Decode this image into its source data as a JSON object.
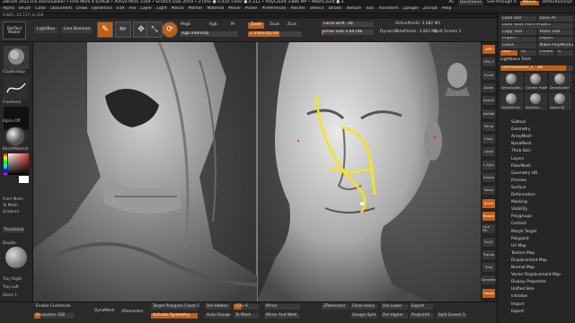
{
  "titlebar": {
    "app": "ZBrush 2022.0.6",
    "document": "DemoSoldier",
    "free_mem": "• Free Mem 4.629GB",
    "active_mem": "• Active Mem 2169",
    "scratch": "• Scratch Disk 2059",
    "ztime": "• ZTime ● 0.434",
    "timer": "Timer ● 0.212",
    "polycount": "• PolyCount 3.886 MP",
    "meshcount": "• MeshCount ● 3",
    "ac": "AC",
    "quicksave": "QuickSave",
    "seethrough": "See-through 0",
    "menus": "Menus",
    "script": "DefaultZScript"
  },
  "menubar": [
    "Alpha",
    "Brush",
    "Color",
    "Document",
    "Draw",
    "Dynamics",
    "Edit",
    "File",
    "Layer",
    "Light",
    "Macro",
    "Marker",
    "Material",
    "Movie",
    "Picker",
    "Preferences",
    "Render",
    "Stencil",
    "Stroke",
    "Texture",
    "Tool",
    "Transform",
    "Zplugin",
    "Zscript",
    "Help"
  ],
  "coords": "0.821,-15.717,-0.316",
  "toolbar": {
    "tool_name": "BoltTool Master",
    "lightbox": "LightBox",
    "live_boolean": "Live Boolean",
    "edit": "Edit",
    "draw": "Draw",
    "move": "Move",
    "scale": "Scale",
    "rotate": "Rotate",
    "mrgb": "Mrgb",
    "rgb": "Rgb",
    "m": "M",
    "zadd": "Zadd",
    "zsub": "Zsub",
    "zcut": "Zcut",
    "rgb_intensity": "Rgb Intensity",
    "z_intensity": "Z Intensity 60",
    "focal_shift": "Focal Shift -36",
    "draw_size": "Draw Size 0.64706",
    "dynamic": "Dynamic",
    "active_points": "ActivePoints: 2.082 Mil",
    "total_points": "TotalPoints: 3.063 Mil",
    "split_screen": "Split Screen 1"
  },
  "left_shelf": {
    "items": [
      "ClayBuildup",
      "FreeHand",
      "Alpha Off",
      "BasicMaterial",
      "From Mesh",
      "To Mesh",
      "Gradient",
      "Thumbnail",
      "Double",
      "Tray Right",
      "Tray Left",
      "Zoom 1"
    ],
    "brush_color": "#e03a3a"
  },
  "right_shelf": [
    "BPR",
    "SPix 3",
    "Scroll",
    "Zoom",
    "Actual",
    "AAHalf",
    "Persp",
    "Floor",
    "Local",
    "L.Sym",
    "Frame",
    "Move",
    "Scale",
    "Rotate",
    "Line Fill",
    "PolyF",
    "Transp",
    "Solo",
    "Dynamic",
    "Xpose"
  ],
  "tray": {
    "buttons": [
      [
        "Load Tool",
        "Save As"
      ],
      [
        "Load Tools From Project",
        ""
      ],
      [
        "Copy Tool",
        "Paste Tool"
      ],
      [
        "Import",
        "Export"
      ],
      [
        "Clone",
        "Make PolyMesh3D"
      ],
      [
        "GoZ",
        "All",
        "Visible",
        "R"
      ]
    ],
    "lightbox_label": "Lightbox ▸ Tools",
    "tool_slider": "DemoSoldier_1 · 48",
    "thumbnails": [
      "DemoSoldier_1",
      "Cylinder PolyMesh",
      "DemoSoldier",
      "SimpleBrush",
      "DemoSol...",
      "Sphere3D"
    ],
    "subpalettes": [
      "Subtool",
      "Geometry",
      "ArrayMesh",
      "NanoMesh",
      "Thick Skin",
      "Layers",
      "FiberMesh",
      "Geometry HD",
      "Preview",
      "Surface",
      "Deformation",
      "Masking",
      "Visibility",
      "Polygroups",
      "Contact",
      "Morph Target",
      "Polypaint",
      "UV Map",
      "Texture Map",
      "Displacement Map",
      "Normal Map",
      "Vector Displacement Map",
      "Display Properties",
      "Unified Skin",
      "Initialize",
      "Import",
      "Export"
    ]
  },
  "bottombar": {
    "enable_customize": "Enable Customize",
    "resolution": "Resolution 128",
    "dynamesh": "DynaMesh",
    "zremesher": "ZRemesher",
    "target_polygons": "Target Polygons Count 5",
    "activate_symmetry": "Activate Symmetry",
    "auto_groups": "Auto Groups",
    "del_hidden": "Del Hidden",
    "to_mesh": "To Mesh",
    "sdiv": "SDiv 6",
    "mirror": "Mirror",
    "mirror_weld": "Mirror And Weld",
    "zremesher2": "ZRemesher",
    "close_holes": "Close Holes",
    "groups_split": "Groups Split",
    "del_lower": "Del Lower",
    "del_higher": "Del Higher",
    "export": "Export",
    "project_all": "ProjectAll",
    "split_screen": "Split Screen 1"
  },
  "colors": {
    "accent": "#c05f18",
    "stroke": "#f5e51a"
  }
}
